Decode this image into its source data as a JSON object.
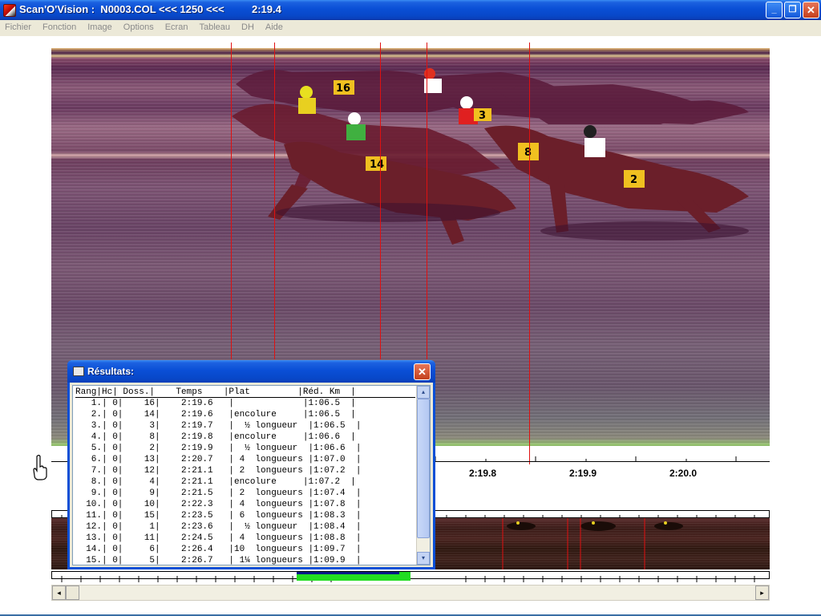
{
  "window": {
    "title": "Scan'O'Vision :  N0003.COL <<< 1250 <<<",
    "time": "2:19.4",
    "buttons": {
      "minimize": "_",
      "maximize": "❐",
      "close": "✕"
    }
  },
  "menu": [
    "Fichier",
    "Fonction",
    "Image",
    "Options",
    "Ecran",
    "Tableau",
    "DH",
    "Aide"
  ],
  "axis": {
    "labels": [
      {
        "text": "2:19.8"
      },
      {
        "text": "2:19.9"
      },
      {
        "text": "2:20.0"
      }
    ]
  },
  "results": {
    "title": "Résultats:",
    "close": "✕",
    "header": "Rang|Hc| Doss.|    Temps    |Plat         |Réd. Km  |",
    "rows": [
      "   1.| 0|    16|    2:19.6   |             |1:06.5  |",
      "   2.| 0|    14|    2:19.6   |encolure     |1:06.5  |",
      "   3.| 0|     3|    2:19.7   |  ½ longueur  |1:06.5  |",
      "   4.| 0|     8|    2:19.8   |encolure     |1:06.6  |",
      "   5.| 0|     2|    2:19.9   |  ½ longueur  |1:06.6  |",
      "   6.| 0|    13|    2:20.7   | 4  longueurs |1:07.0  |",
      "   7.| 0|    12|    2:21.1   | 2  longueurs |1:07.2  |",
      "   8.| 0|     4|    2:21.1   |encolure     |1:07.2  |",
      "   9.| 0|     9|    2:21.5   | 2  longueurs |1:07.4  |",
      "  10.| 0|    10|    2:22.3   | 4  longueurs |1:07.8  |",
      "  11.| 0|    15|    2:23.5   | 6  longueurs |1:08.3  |",
      "  12.| 0|     1|    2:23.6   |  ½ longueur  |1:08.4  |",
      "  13.| 0|    11|    2:24.5   | 4  longueurs |1:08.8  |",
      "  14.| 0|     6|    2:26.4   |10  longueurs |1:09.7  |",
      "  15.| 0|     5|    2:26.7   | 1¼ longueurs |1:09.9  |"
    ]
  },
  "photo": {
    "saddle_numbers": [
      "14",
      "3",
      "8",
      "2",
      "16"
    ]
  },
  "scrollbar": {
    "left_arrow": "◂",
    "right_arrow": "▸",
    "up_arrow": "▴",
    "down_arrow": "▾"
  }
}
